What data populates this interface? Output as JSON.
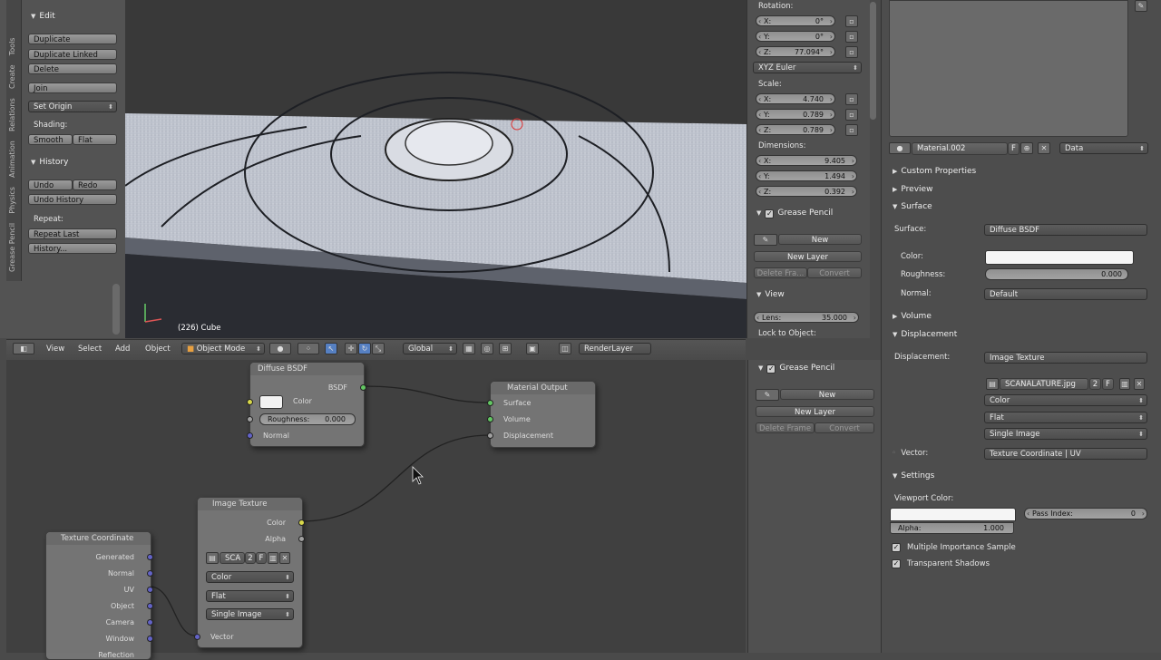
{
  "tool_shelf": {
    "tabs": [
      "Tools",
      "Create",
      "Relations",
      "Animation",
      "Physics",
      "Grease Pencil"
    ],
    "edit_header": "Edit",
    "buttons": {
      "duplicate": "Duplicate",
      "duplicate_linked": "Duplicate Linked",
      "delete": "Delete",
      "join": "Join",
      "set_origin": "Set Origin"
    },
    "shading_label": "Shading:",
    "smooth": "Smooth",
    "flat": "Flat",
    "history_header": "History",
    "undo": "Undo",
    "redo": "Redo",
    "undo_history": "Undo History",
    "repeat_label": "Repeat:",
    "repeat_last": "Repeat Last",
    "history_btn": "History..."
  },
  "viewport": {
    "object_label": "(226) Cube"
  },
  "viewport_header": {
    "menus": [
      "View",
      "Select",
      "Add",
      "Object"
    ],
    "mode": "Object Mode",
    "orientation": "Global",
    "render_layer": "RenderLayer"
  },
  "n_panel": {
    "rotation_label": "Rotation:",
    "rotation": [
      {
        "axis": "X:",
        "value": "0°"
      },
      {
        "axis": "Y:",
        "value": "0°"
      },
      {
        "axis": "Z:",
        "value": "77.094°"
      }
    ],
    "rotation_mode": "XYZ Euler",
    "scale_label": "Scale:",
    "scale": [
      {
        "axis": "X:",
        "value": "4.740"
      },
      {
        "axis": "Y:",
        "value": "0.789"
      },
      {
        "axis": "Z:",
        "value": "0.789"
      }
    ],
    "dimensions_label": "Dimensions:",
    "dimensions": [
      {
        "axis": "X:",
        "value": "9.405"
      },
      {
        "axis": "Y:",
        "value": "1.494"
      },
      {
        "axis": "Z:",
        "value": "0.392"
      }
    ],
    "grease_pencil": "Grease Pencil",
    "new": "New",
    "new_layer": "New Layer",
    "delete_frame": "Delete Fra...",
    "convert": "Convert",
    "view_header": "View",
    "lens_label": "Lens:",
    "lens_value": "35.000",
    "lock_to_object": "Lock to Object:"
  },
  "node_sidebar": {
    "grease_pencil": "Grease Pencil",
    "new": "New",
    "new_layer": "New Layer",
    "delete_frame": "Delete Frame",
    "convert": "Convert"
  },
  "nodes": {
    "diffuse": {
      "title": "Diffuse BSDF",
      "out": "BSDF",
      "color": "Color",
      "roughness": "Roughness:",
      "roughness_value": "0.000",
      "normal": "Normal"
    },
    "output": {
      "title": "Material Output",
      "surface": "Surface",
      "volume": "Volume",
      "displacement": "Displacement"
    },
    "image": {
      "title": "Image Texture",
      "out_color": "Color",
      "out_alpha": "Alpha",
      "img": "SCA",
      "num": "2",
      "f": "F",
      "color": "Color",
      "flat": "Flat",
      "single": "Single Image",
      "vector": "Vector"
    },
    "texcoord": {
      "title": "Texture Coordinate",
      "outputs": [
        "Generated",
        "Normal",
        "UV",
        "Object",
        "Camera",
        "Window",
        "Reflection"
      ]
    }
  },
  "properties": {
    "material_name": "Material.002",
    "f": "F",
    "link": "Data",
    "custom_properties": "Custom Properties",
    "preview": "Preview",
    "surface_header": "Surface",
    "surface_label": "Surface:",
    "surface_value": "Diffuse BSDF",
    "color_label": "Color:",
    "roughness_label": "Roughness:",
    "roughness_value": "0.000",
    "normal_label": "Normal:",
    "normal_value": "Default",
    "volume_header": "Volume",
    "displacement_header": "Displacement",
    "displacement_label": "Displacement:",
    "displacement_value": "Image Texture",
    "image_name": "SCANALATURE.jpg",
    "image_num": "2",
    "image_f": "F",
    "color_mode": "Color",
    "interpolation": "Flat",
    "source": "Single Image",
    "vector_label": "Vector:",
    "vector_value": "Texture Coordinate | UV",
    "settings_header": "Settings",
    "viewport_color": "Viewport Color:",
    "alpha_label": "Alpha:",
    "alpha_value": "1.000",
    "pass_index_label": "Pass Index:",
    "pass_index_value": "0",
    "mis": "Multiple Importance Sample",
    "transparent_shadows": "Transparent Shadows"
  },
  "colors": {
    "accent": "#5680c2",
    "bg": "#4a4a4a",
    "node": "#787878"
  }
}
